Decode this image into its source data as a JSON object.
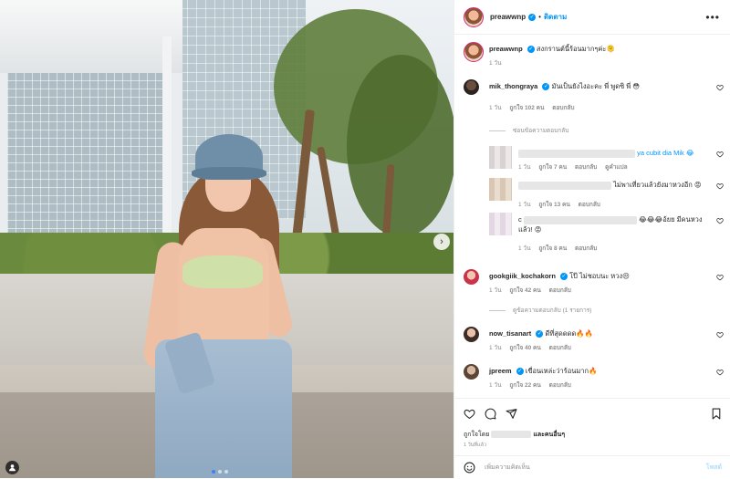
{
  "post": {
    "author": "preawwnp",
    "follow_label": "ติดตาม",
    "separator": "•",
    "caption": "สงกรานต์นี้ร้อนมากๆค่ะ🫠",
    "caption_time": "1 วัน"
  },
  "comments": [
    {
      "username": "mik_thongraya",
      "text": "มันเป็นยังไงอะคะ พี่ พูดซิ พี่ 😳",
      "time": "1 วัน",
      "likes": "ถูกใจ 102 คน",
      "reply": "ตอบกลับ"
    }
  ],
  "hide_replies": "ซ่อนข้อความตอบกลับ",
  "replies": [
    {
      "text_suffix": "ya cubit dia Mik 😂",
      "time": "1 วัน",
      "likes": "ถูกใจ 7 คน",
      "reply": "ตอบกลับ",
      "translate": "ดูคำแปล"
    },
    {
      "text_suffix": "ไม่พาเที่ยวแล้วยังมาหวงอีก 😡",
      "time": "1 วัน",
      "likes": "ถูกใจ 13 คน",
      "reply": "ตอบกลับ"
    },
    {
      "text_prefix": "c",
      "text_suffix": "😂😂😂อ้ยย มีคนหวงแล้ว! 😡",
      "time": "1 วัน",
      "likes": "ถูกใจ 8 คน",
      "reply": "ตอบกลับ"
    }
  ],
  "comments2": [
    {
      "username": "gookgiik_kochakorn",
      "text": "โป๊ ไม่ชอบนะ หวง😒",
      "time": "1 วัน",
      "likes": "ถูกใจ 42 คน",
      "reply": "ตอบกลับ",
      "view_replies": "ดูข้อความตอบกลับ (1 รายการ)"
    },
    {
      "username": "now_tisanart",
      "text": "ดีที่สุดดดด🔥🔥",
      "time": "1 วัน",
      "likes": "ถูกใจ 40 คน",
      "reply": "ตอบกลับ"
    },
    {
      "username": "jpreem",
      "text": "เขื่อนเหล่ะว่าร้อนมาก🔥",
      "time": "1 วัน",
      "likes": "ถูกใจ 22 คน",
      "reply": "ตอบกลับ"
    }
  ],
  "footer": {
    "liked_by_prefix": "ถูกใจโดย",
    "liked_by_suffix": "และคนอื่นๆ",
    "time_ago": "1 วันที่แล้ว",
    "comment_placeholder": "เพิ่มความคิดเห็น",
    "post_label": "โพสต์"
  },
  "icons": {
    "more": "more-options-icon",
    "heart": "heart-icon",
    "comment": "comment-icon",
    "share": "share-icon",
    "save": "bookmark-icon",
    "emoji": "emoji-icon",
    "tag": "user-tag-icon",
    "next": "chevron-right-icon"
  },
  "colors": {
    "accent": "#0095f6",
    "muted": "#8e8e8e",
    "text": "#262626"
  }
}
